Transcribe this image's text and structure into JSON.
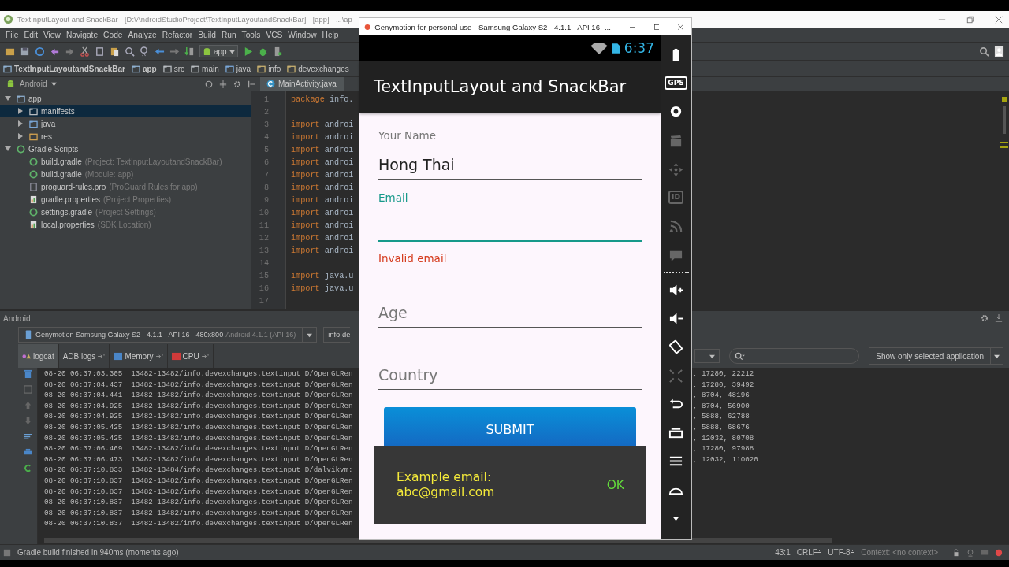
{
  "ide": {
    "title": "TextInputLayout and SnackBar - [D:\\AndroidStudioProject\\TextInputLayoutandSnackBar] - [app] - ...\\ap",
    "menu": [
      "File",
      "Edit",
      "View",
      "Navigate",
      "Code",
      "Analyze",
      "Refactor",
      "Build",
      "Run",
      "Tools",
      "VCS",
      "Window",
      "Help"
    ],
    "run_config": "app",
    "breadcrumb": [
      {
        "label": "TextInputLayoutandSnackBar",
        "kind": "module"
      },
      {
        "label": "app",
        "kind": "module"
      },
      {
        "label": "src",
        "kind": "folder"
      },
      {
        "label": "main",
        "kind": "folder"
      },
      {
        "label": "java",
        "kind": "source"
      },
      {
        "label": "info",
        "kind": "package"
      },
      {
        "label": "devexchanges",
        "kind": "package"
      }
    ],
    "project_view": "Android",
    "editor_tab": {
      "label": "MainActivity.java",
      "selected": true
    },
    "tree": [
      {
        "name": "app",
        "kind": "module",
        "expanded": true,
        "selected": false,
        "children": [
          {
            "name": "manifests",
            "kind": "folder",
            "expanded": false,
            "selected": true
          },
          {
            "name": "java",
            "kind": "source",
            "expanded": false,
            "selected": false
          },
          {
            "name": "res",
            "kind": "res",
            "expanded": false,
            "selected": false
          }
        ]
      },
      {
        "name": "Gradle Scripts",
        "kind": "gradle",
        "expanded": true,
        "selected": false,
        "children": [
          {
            "name": "build.gradle",
            "hint": "(Project: TextInputLayoutandSnackBar)",
            "kind": "gradle",
            "selected": false
          },
          {
            "name": "build.gradle",
            "hint": "(Module: app)",
            "kind": "gradle",
            "selected": false
          },
          {
            "name": "proguard-rules.pro",
            "hint": "(ProGuard Rules for app)",
            "kind": "file",
            "selected": false
          },
          {
            "name": "gradle.properties",
            "hint": "(Project Properties)",
            "kind": "properties",
            "selected": false
          },
          {
            "name": "settings.gradle",
            "hint": "(Project Settings)",
            "kind": "gradle",
            "selected": false
          },
          {
            "name": "local.properties",
            "hint": "(SDK Location)",
            "kind": "properties",
            "selected": false
          }
        ]
      }
    ],
    "code_lines": [
      {
        "number": "1",
        "keyword": "package",
        "rest": " info."
      },
      {
        "number": "2"
      },
      {
        "number": "3",
        "keyword": "import",
        "rest": " androi"
      },
      {
        "number": "4",
        "keyword": "import",
        "rest": " androi"
      },
      {
        "number": "5",
        "keyword": "import",
        "rest": " androi"
      },
      {
        "number": "6",
        "keyword": "import",
        "rest": " androi"
      },
      {
        "number": "7",
        "keyword": "import",
        "rest": " androi"
      },
      {
        "number": "8",
        "keyword": "import",
        "rest": " androi"
      },
      {
        "number": "9",
        "keyword": "import",
        "rest": " androi"
      },
      {
        "number": "10",
        "keyword": "import",
        "rest": " androi"
      },
      {
        "number": "11",
        "keyword": "import",
        "rest": " androi"
      },
      {
        "number": "12",
        "keyword": "import",
        "rest": " androi"
      },
      {
        "number": "13",
        "keyword": "import",
        "rest": " androi"
      },
      {
        "number": "14"
      },
      {
        "number": "15",
        "keyword": "import",
        "rest": " java.u"
      },
      {
        "number": "16",
        "keyword": "import",
        "rest": " java.u"
      },
      {
        "number": "17"
      }
    ],
    "bottom_panel": {
      "title": "Android",
      "device": "Genymotion Samsung Galaxy S2 - 4.1.1 - API 16 - 480x800",
      "device_hint": "Android 4.1.1 (API 16)",
      "process": "info.de",
      "tabs": [
        {
          "label": "logcat",
          "kind": "logcat",
          "selected": true
        },
        {
          "label": "ADB logs",
          "kind": "adb",
          "selected": false
        },
        {
          "label": "Memory",
          "kind": "memory",
          "selected": false
        },
        {
          "label": "CPU",
          "kind": "cpu",
          "selected": false
        }
      ],
      "filter": "Show only selected application",
      "log_rows": [
        {
          "text": "08-20 06:37:03.305  13482-13482/info.devexchanges.textinput D/OpenGLRen",
          "tail": ", 17280, 22212"
        },
        {
          "text": "08-20 06:37:04.437  13482-13482/info.devexchanges.textinput D/OpenGLRen",
          "tail": ", 17280, 39492"
        },
        {
          "text": "08-20 06:37:04.441  13482-13482/info.devexchanges.textinput D/OpenGLRen",
          "tail": ", 8704, 48196"
        },
        {
          "text": "08-20 06:37:04.925  13482-13482/info.devexchanges.textinput D/OpenGLRen",
          "tail": ", 8704, 56900"
        },
        {
          "text": "08-20 06:37:04.925  13482-13482/info.devexchanges.textinput D/OpenGLRen",
          "tail": ", 5888, 62788"
        },
        {
          "text": "08-20 06:37:05.425  13482-13482/info.devexchanges.textinput D/OpenGLRen",
          "tail": ", 5888, 68676"
        },
        {
          "text": "08-20 06:37:05.425  13482-13482/info.devexchanges.textinput D/OpenGLRen",
          "tail": ", 12032, 80708"
        },
        {
          "text": "08-20 06:37:06.469  13482-13482/info.devexchanges.textinput D/OpenGLRen",
          "tail": ", 17280, 97988"
        },
        {
          "text": "08-20 06:37:06.473  13482-13482/info.devexchanges.textinput D/OpenGLRen",
          "tail": ", 12032, 110020"
        },
        {
          "text": "08-20 06:37:10.833  13482-13484/info.devexchanges.textinput D/dalvikvm:"
        },
        {
          "text": "08-20 06:37:10.837  13482-13482/info.devexchanges.textinput D/OpenGLRen"
        },
        {
          "text": "08-20 06:37:10.837  13482-13482/info.devexchanges.textinput D/OpenGLRen"
        },
        {
          "text": "08-20 06:37:10.837  13482-13482/info.devexchanges.textinput D/OpenGLRen"
        },
        {
          "text": "08-20 06:37:10.837  13482-13482/info.devexchanges.textinput D/OpenGLRen"
        },
        {
          "text": "08-20 06:37:10.837  13482-13482/info.devexchanges.textinput D/OpenGLRen"
        }
      ]
    },
    "status_bar": {
      "message": "Gradle build finished in 940ms (moments ago)",
      "position": "43:1",
      "line_separator": "CRLF÷",
      "encoding": "UTF-8÷",
      "context": "Context: <no context>"
    }
  },
  "emulator": {
    "title": "Genymotion for personal use - Samsung Galaxy S2 - 4.1.1 - API 16 -...",
    "clock": "6:37",
    "app_title": "TextInputLayout and SnackBar",
    "fields": [
      {
        "label": "Your Name",
        "value": "Hong Thai",
        "focused": false
      },
      {
        "label": "Email",
        "focused": true,
        "error": "Invalid email"
      },
      {
        "placeholder": "Age",
        "focused": false
      },
      {
        "placeholder": "Country",
        "focused": false
      }
    ],
    "submit": "SUBMIT",
    "snackbar": {
      "message": "Example email: abc@gmail.com",
      "action": "OK"
    },
    "sidebar": [
      {
        "kind": "battery",
        "disabled": false
      },
      {
        "kind": "gps",
        "label": "GPS",
        "disabled": false
      },
      {
        "kind": "webcam",
        "disabled": false
      },
      {
        "kind": "video",
        "disabled": true
      },
      {
        "kind": "move",
        "disabled": true
      },
      {
        "kind": "id",
        "label": "ID",
        "disabled": true
      },
      {
        "kind": "rss",
        "disabled": true
      },
      {
        "kind": "sms",
        "disabled": true
      },
      {
        "kind": "separator"
      },
      {
        "kind": "volume-up",
        "disabled": false
      },
      {
        "kind": "volume-down",
        "disabled": false
      },
      {
        "kind": "rotate",
        "disabled": false
      },
      {
        "kind": "scale",
        "disabled": true
      },
      {
        "kind": "back",
        "disabled": false
      },
      {
        "kind": "recent",
        "disabled": false
      },
      {
        "kind": "menu",
        "disabled": false
      },
      {
        "kind": "home",
        "disabled": false
      },
      {
        "kind": "down",
        "disabled": false
      }
    ]
  }
}
